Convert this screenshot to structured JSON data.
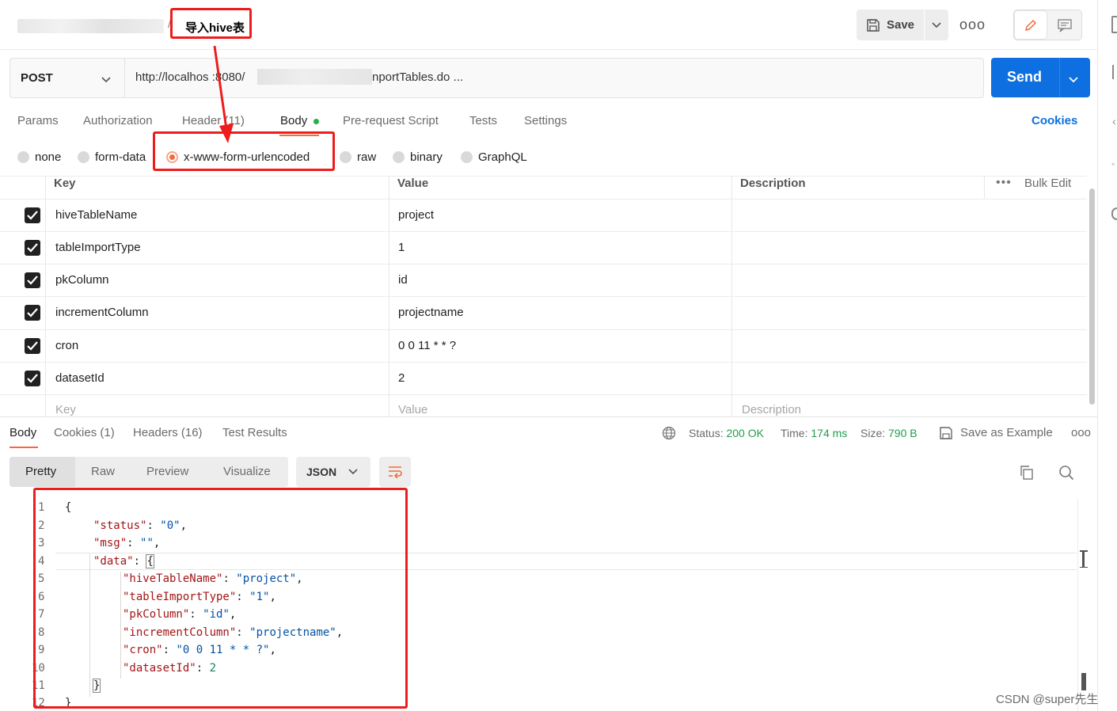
{
  "header": {
    "breadcrumb_sep": "/",
    "title": "导入hive表",
    "save_label": "Save",
    "more_label": "ooo"
  },
  "request": {
    "method": "POST",
    "url_prefix": "http://localhos :8080/",
    "url_suffix": "nportTables.do ...",
    "send_label": "Send"
  },
  "request_tabs": [
    {
      "label": "Params"
    },
    {
      "label": "Authorization"
    },
    {
      "label": "Header  (11)"
    },
    {
      "label": "Body"
    },
    {
      "label": "Pre-request Script"
    },
    {
      "label": "Tests"
    },
    {
      "label": "Settings"
    }
  ],
  "cookies_label": "Cookies",
  "body_types": [
    {
      "label": "none"
    },
    {
      "label": "form-data"
    },
    {
      "label": "x-www-form-urlencoded"
    },
    {
      "label": "raw"
    },
    {
      "label": "binary"
    },
    {
      "label": "GraphQL"
    }
  ],
  "params_table": {
    "headers": {
      "key": "Key",
      "value": "Value",
      "description": "Description"
    },
    "bulk_edit": "Bulk Edit",
    "rows": [
      {
        "key": "hiveTableName",
        "value": "project"
      },
      {
        "key": "tableImportType",
        "value": "1"
      },
      {
        "key": "pkColumn",
        "value": "id"
      },
      {
        "key": "incrementColumn",
        "value": "projectname"
      },
      {
        "key": "cron",
        "value": "0 0 11 * * ?"
      },
      {
        "key": "datasetId",
        "value": "2"
      }
    ],
    "placeholder": {
      "key": "Key",
      "value": "Value",
      "description": "Description"
    }
  },
  "response": {
    "tabs": [
      {
        "label": "Body"
      },
      {
        "label": "Cookies (1)"
      },
      {
        "label": "Headers (16)"
      },
      {
        "label": "Test Results"
      }
    ],
    "status_label": "Status:",
    "status_value": "200 OK",
    "time_label": "Time:",
    "time_value": "174 ms",
    "size_label": "Size:",
    "size_value": "790 B",
    "save_example": "Save as Example",
    "more_label": "ooo"
  },
  "viewer": {
    "tabs": [
      {
        "label": "Pretty"
      },
      {
        "label": "Raw"
      },
      {
        "label": "Preview"
      },
      {
        "label": "Visualize"
      }
    ],
    "format": "JSON"
  },
  "code": {
    "line_numbers": [
      "1",
      "2",
      "3",
      "4",
      "5",
      "6",
      "7",
      "8",
      "9",
      "10",
      "11",
      "12"
    ],
    "status_key": "\"status\"",
    "status_val": "\"0\"",
    "msg_key": "\"msg\"",
    "msg_val": "\"\"",
    "data_key": "\"data\"",
    "hive_key": "\"hiveTableName\"",
    "hive_val": "\"project\"",
    "type_key": "\"tableImportType\"",
    "type_val": "\"1\"",
    "pk_key": "\"pkColumn\"",
    "pk_val": "\"id\"",
    "inc_key": "\"incrementColumn\"",
    "inc_val": "\"projectname\"",
    "cron_key": "\"cron\"",
    "cron_val": "\"0 0 11 * * ?\"",
    "ds_key": "\"datasetId\"",
    "ds_val": "2",
    "open_brace": "{",
    "close_brace": "}"
  },
  "watermark": "CSDN @super先生",
  "colors": {
    "accent": "#f26b3a",
    "send": "#0d6fe0",
    "status_ok": "#1f9e4a",
    "highlight": "#ee1c1c"
  }
}
